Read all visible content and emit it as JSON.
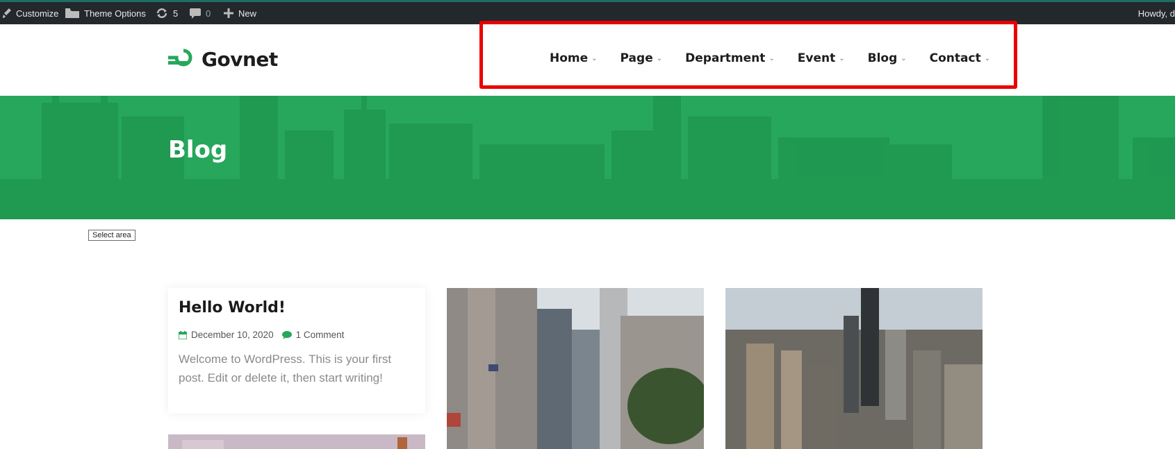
{
  "adminbar": {
    "customize": "Customize",
    "theme_options": "Theme Options",
    "updates_count": "5",
    "comments_count": "0",
    "new": "New",
    "howdy": "Howdy, d"
  },
  "header": {
    "logo_text": "Govnet",
    "nav": [
      {
        "label": "Home"
      },
      {
        "label": "Page"
      },
      {
        "label": "Department"
      },
      {
        "label": "Event"
      },
      {
        "label": "Blog"
      },
      {
        "label": "Contact"
      }
    ]
  },
  "banner": {
    "title": "Blog"
  },
  "select_area": "Select area",
  "posts": [
    {
      "title": "Hello World!",
      "date": "December 10, 2020",
      "comments": "1 Comment",
      "excerpt": "Welcome to WordPress. This is your first post. Edit or delete it, then start writing!"
    }
  ],
  "colors": {
    "brand_green": "#27a75c",
    "admin_bar": "#23282d",
    "highlight_red": "#ea0000"
  },
  "icons": [
    "brush-icon",
    "folder-icon",
    "updates-icon",
    "comment-icon",
    "plus-icon",
    "logo-icon",
    "chevron-down-icon",
    "calendar-icon",
    "comment-bubble-icon"
  ]
}
